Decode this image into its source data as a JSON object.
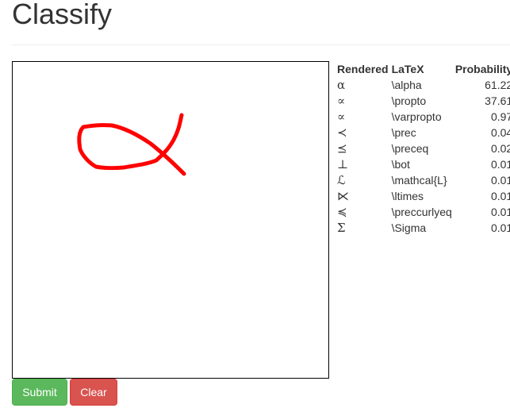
{
  "page": {
    "title": "Classify"
  },
  "buttons": {
    "submit_label": "Submit",
    "clear_label": "Clear"
  },
  "colors": {
    "submit": "#5cb85c",
    "clear": "#d9534f",
    "stroke": "#ff0000"
  },
  "table": {
    "headers": {
      "rendered": "Rendered",
      "latex": "LaTeX",
      "probability": "Probability"
    },
    "rows": [
      {
        "rendered": "α",
        "latex": "\\alpha",
        "probability": "61.22"
      },
      {
        "rendered": "∝",
        "latex": "\\propto",
        "probability": "37.61"
      },
      {
        "rendered": "∝",
        "latex": "\\varpropto",
        "probability": "0.97"
      },
      {
        "rendered": "≺",
        "latex": "\\prec",
        "probability": "0.04"
      },
      {
        "rendered": "⪯",
        "latex": "\\preceq",
        "probability": "0.02"
      },
      {
        "rendered": "⊥",
        "latex": "\\bot",
        "probability": "0.01"
      },
      {
        "rendered": "ℒ",
        "latex": "\\mathcal{L}",
        "probability": "0.01"
      },
      {
        "rendered": "⋉",
        "latex": "\\ltimes",
        "probability": "0.01"
      },
      {
        "rendered": "≼",
        "latex": "\\preccurlyeq",
        "probability": "0.01"
      },
      {
        "rendered": "Σ",
        "latex": "\\Sigma",
        "probability": "0.01"
      }
    ]
  }
}
